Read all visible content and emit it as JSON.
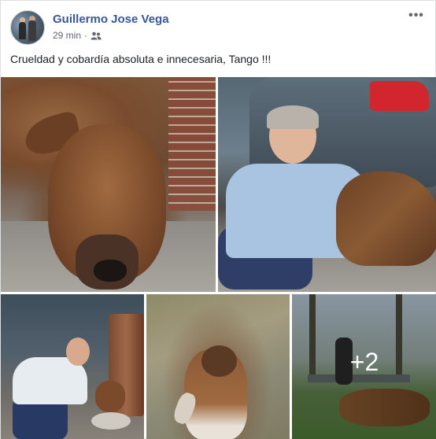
{
  "post": {
    "author": "Guillermo Jose Vega",
    "time": "29 min",
    "separator": "·",
    "privacy_icon": "friends-icon",
    "more_icon": "more-options-icon",
    "more_glyph": "•••",
    "text": "Crueldad y cobardía absoluta e innecesaria, Tango !!!",
    "photos": [
      {
        "description_icon": "photo"
      },
      {
        "description_icon": "photo"
      },
      {
        "description_icon": "photo"
      },
      {
        "description_icon": "photo"
      },
      {
        "description_icon": "photo",
        "more_count": "+2"
      }
    ]
  },
  "colors": {
    "author_link": "#385898",
    "meta_text": "#616770",
    "body_text": "#1c1e21"
  }
}
